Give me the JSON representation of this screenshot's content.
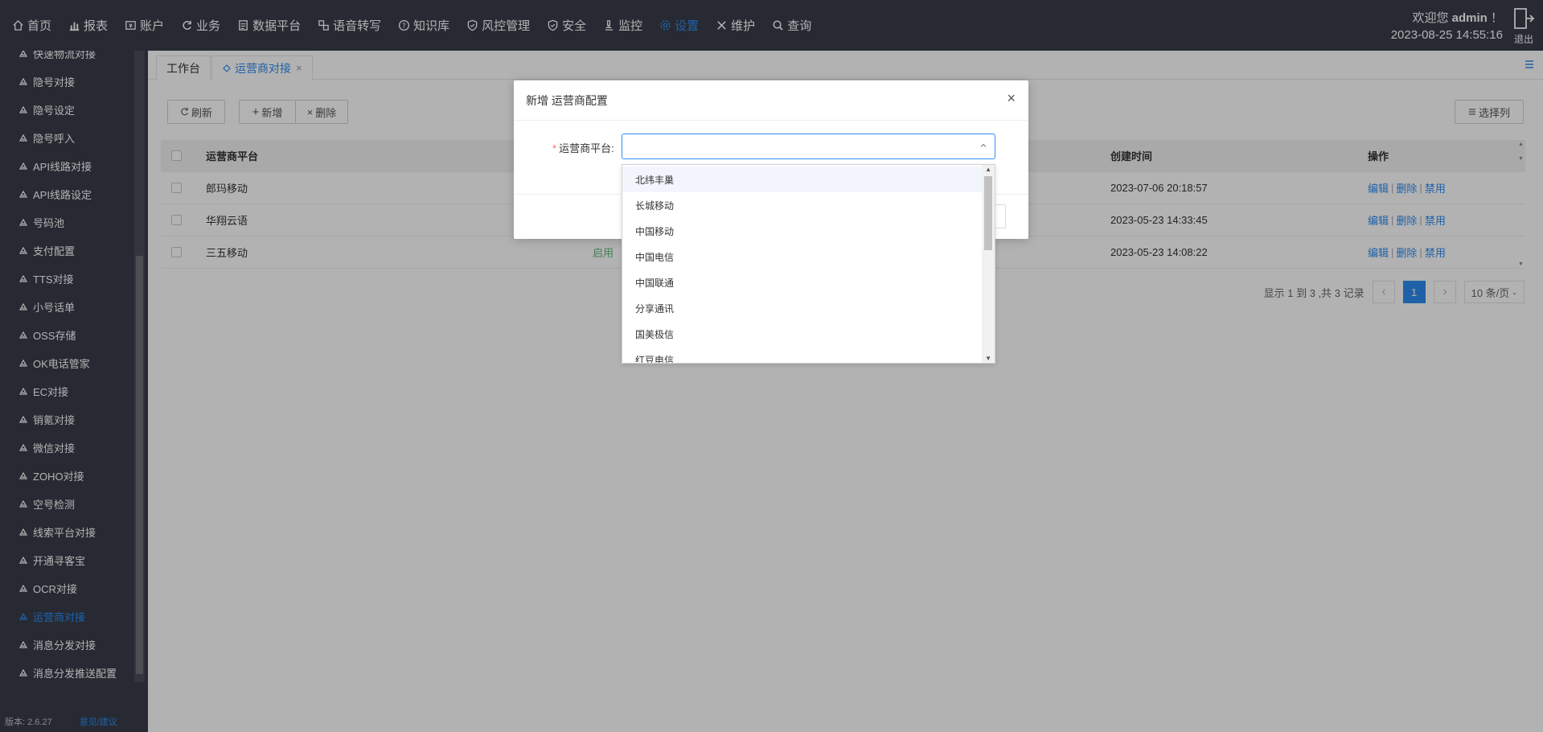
{
  "nav": {
    "items": [
      {
        "icon": "home-icon",
        "label": "首页"
      },
      {
        "icon": "bar-chart-icon",
        "label": "报表"
      },
      {
        "icon": "account-icon",
        "label": "账户"
      },
      {
        "icon": "refresh-icon",
        "label": "业务"
      },
      {
        "icon": "document-icon",
        "label": "数据平台"
      },
      {
        "icon": "link-icon",
        "label": "语音转写"
      },
      {
        "icon": "question-icon",
        "label": "知识库"
      },
      {
        "icon": "shield-icon",
        "label": "风控管理"
      },
      {
        "icon": "shield-check-icon",
        "label": "安全"
      },
      {
        "icon": "microscope-icon",
        "label": "监控"
      },
      {
        "icon": "gear-icon",
        "label": "设置"
      },
      {
        "icon": "wrench-icon",
        "label": "维护"
      },
      {
        "icon": "search-icon",
        "label": "查询"
      }
    ],
    "active_index": 10,
    "welcome_prefix": "欢迎您",
    "username": "admin",
    "welcome_suffix": "！",
    "datetime": "2023-08-25 14:55:16",
    "logout_label": "退出"
  },
  "sidebar": {
    "items": [
      {
        "label": "快速物流对接"
      },
      {
        "label": "隐号对接"
      },
      {
        "label": "隐号设定"
      },
      {
        "label": "隐号呼入"
      },
      {
        "label": "API线路对接"
      },
      {
        "label": "API线路设定"
      },
      {
        "label": "号码池"
      },
      {
        "label": "支付配置"
      },
      {
        "label": "TTS对接"
      },
      {
        "label": "小号话单"
      },
      {
        "label": "OSS存储"
      },
      {
        "label": "OK电话管家"
      },
      {
        "label": "EC对接"
      },
      {
        "label": "销氪对接"
      },
      {
        "label": "微信对接"
      },
      {
        "label": "ZOHO对接"
      },
      {
        "label": "空号检测"
      },
      {
        "label": "线索平台对接"
      },
      {
        "label": "开通寻客宝"
      },
      {
        "label": "OCR对接"
      },
      {
        "label": "运营商对接"
      },
      {
        "label": "消息分发对接"
      },
      {
        "label": "消息分发推送配置"
      }
    ],
    "active_index": 20,
    "version": "版本: 2.6.27",
    "feedback": "意见/建议"
  },
  "tabs": {
    "workbench": "工作台",
    "current": "运营商对接",
    "close": "×"
  },
  "toolbar": {
    "refresh": "刷新",
    "add": "新增",
    "delete": "删除",
    "columns": "选择列"
  },
  "table": {
    "headers": {
      "platform": "运营商平台",
      "created": "创建时间",
      "ops": "操作"
    },
    "rows": [
      {
        "platform": "郎玛移动",
        "status": "",
        "created": "2023-07-06 20:18:57",
        "edit": "编辑",
        "del": "删除",
        "disable": "禁用"
      },
      {
        "platform": "华翔云语",
        "status": "",
        "created": "2023-05-23 14:33:45",
        "edit": "编辑",
        "del": "删除",
        "disable": "禁用"
      },
      {
        "platform": "三五移动",
        "status": "启用",
        "created": "2023-05-23 14:08:22",
        "edit": "编辑",
        "del": "删除",
        "disable": "禁用"
      }
    ],
    "sep": "|"
  },
  "pager": {
    "summary": "显示 1 到 3 ,共 3 记录",
    "current_page": "1",
    "page_size": "10 条/页"
  },
  "modal": {
    "title": "新增 运营商配置",
    "field_label": "运营商平台:",
    "required_mark": "*",
    "select_value": "",
    "options": [
      "北纬丰巢",
      "长城移动",
      "中国移动",
      "中国电信",
      "中国联通",
      "分享通讯",
      "国美极信",
      "红豆电信"
    ],
    "hover_index": 0
  }
}
